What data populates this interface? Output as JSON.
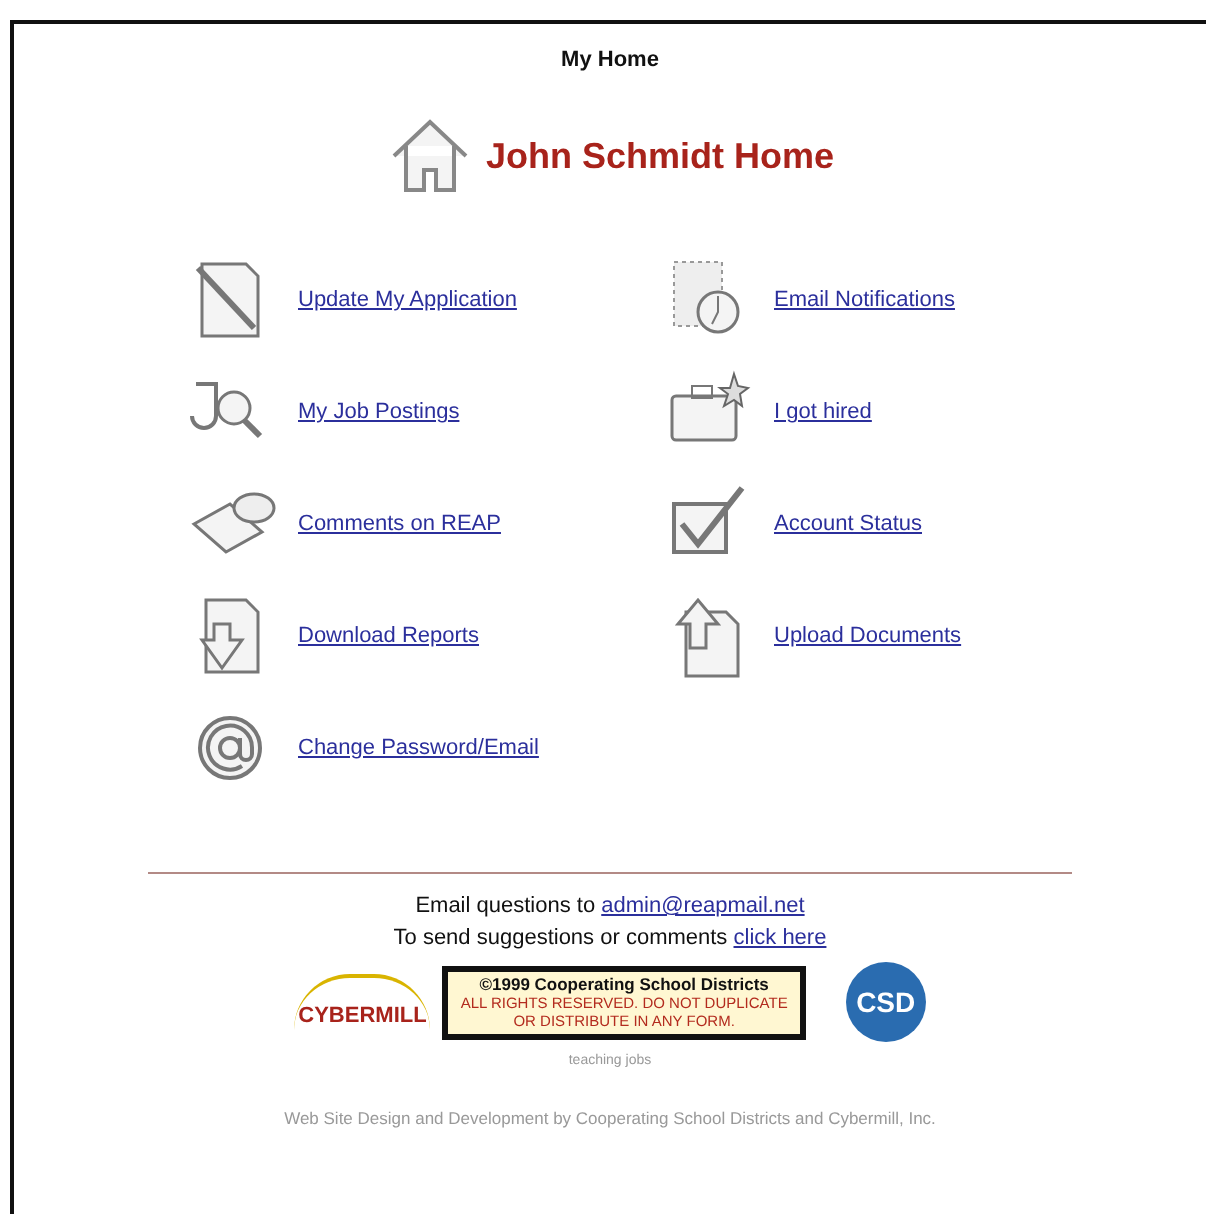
{
  "window": {
    "title": "My Home"
  },
  "header": {
    "title": "John Schmidt Home"
  },
  "links": [
    {
      "label": "Update My Application"
    },
    {
      "label": "Email Notifications"
    },
    {
      "label": "My Job Postings"
    },
    {
      "label": "I got hired"
    },
    {
      "label": "Comments on REAP"
    },
    {
      "label": "Account Status"
    },
    {
      "label": "Download Reports"
    },
    {
      "label": "Upload Documents"
    },
    {
      "label": "Change Password/Email"
    }
  ],
  "footer": {
    "email_prefix": "Email questions to ",
    "email_link": "admin@reapmail.net",
    "suggest_prefix": "To send suggestions or comments ",
    "suggest_link": "click here",
    "logo_left": "CYBERMILL",
    "copyright_line1": "©1999  Cooperating School Districts",
    "copyright_line2": "ALL RIGHTS RESERVED. DO NOT DUPLICATE",
    "copyright_line3": "OR DISTRIBUTE IN ANY FORM.",
    "logo_right": "CSD",
    "tagline": "teaching jobs",
    "credit": "Web Site Design and Development by Cooperating School Districts and Cybermill, Inc."
  }
}
